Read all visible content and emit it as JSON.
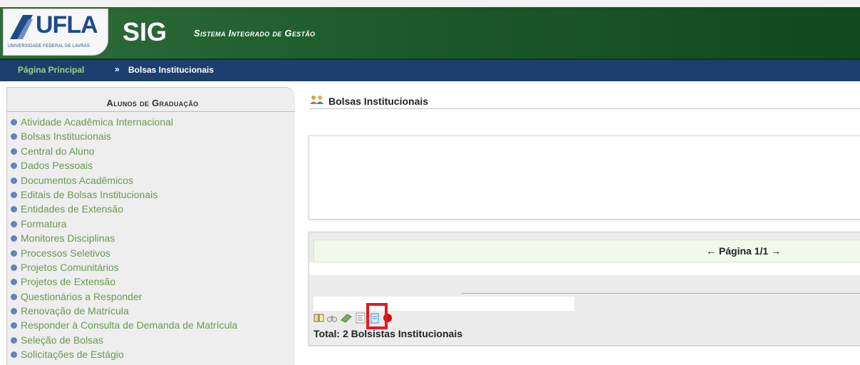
{
  "header": {
    "logo_text": "UFLA",
    "logo_subtitle": "UNIVERSIDADE FEDERAL DE LAVRAS",
    "app_name": "SIG",
    "app_full_name": "Sistema Integrado de Gestão"
  },
  "breadcrumb": {
    "home": "Página Principal",
    "separator": "»",
    "current": "Bolsas Institucionais"
  },
  "sidebar": {
    "title": "Alunos de Graduação",
    "items": [
      {
        "label": "Atividade Acadêmica Internacional"
      },
      {
        "label": "Bolsas Institucionais"
      },
      {
        "label": "Central do Aluno"
      },
      {
        "label": "Dados Pessoais"
      },
      {
        "label": "Documentos Acadêmicos"
      },
      {
        "label": "Editais de Bolsas Institucionais"
      },
      {
        "label": "Entidades de Extensão"
      },
      {
        "label": "Formatura"
      },
      {
        "label": "Monitores Disciplinas"
      },
      {
        "label": "Processos Seletivos"
      },
      {
        "label": "Projetos Comunitários"
      },
      {
        "label": "Projetos de Extensão"
      },
      {
        "label": "Questionários a Responder"
      },
      {
        "label": "Renovação de Matrícula"
      },
      {
        "label": "Responder à Consulta de Demanda de Matrícula"
      },
      {
        "label": "Seleção de Bolsas"
      },
      {
        "label": "Solicitações de Estágio"
      }
    ]
  },
  "main": {
    "title": "Bolsas Institucionais",
    "title_icon": "users-icon",
    "pagination": "← Página 1/1 →",
    "toolbar_icons": [
      "book-icon",
      "binoculars-icon",
      "money-icon",
      "document-list-icon",
      "clipboard-icon",
      "stop-icon"
    ],
    "total_text": "Total: 2 Bolsistas Institucionais"
  },
  "colors": {
    "header_green": "#1d5a2a",
    "breadcrumb_blue": "#1c3f6e",
    "menu_link_green": "#6b9a4f",
    "highlight_red": "#e21b22"
  }
}
